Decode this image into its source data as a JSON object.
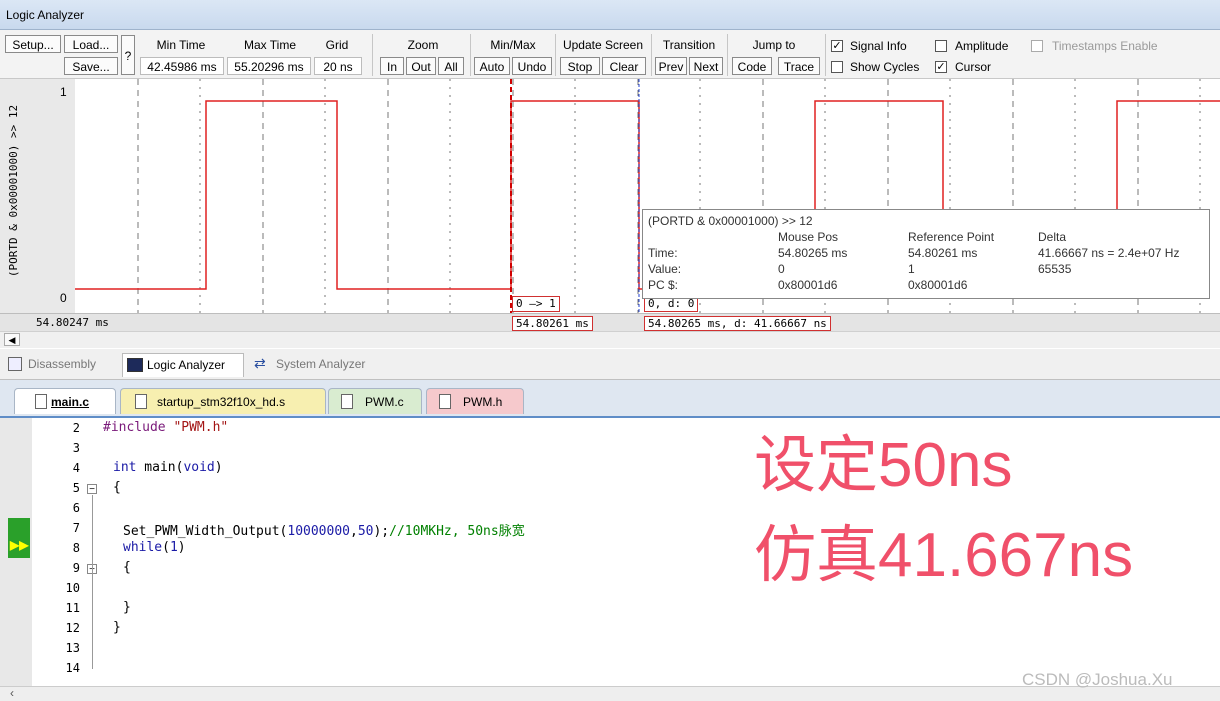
{
  "window": {
    "title": "Logic Analyzer"
  },
  "toolbar": {
    "setup": "Setup...",
    "load": "Load...",
    "save": "Save...",
    "help": "?",
    "min_time_label": "Min Time",
    "min_time_value": "42.45986 ms",
    "max_time_label": "Max Time",
    "max_time_value": "55.20296 ms",
    "grid_label": "Grid",
    "grid_value": "20 ns",
    "zoom_label": "Zoom",
    "zoom_in": "In",
    "zoom_out": "Out",
    "zoom_all": "All",
    "minmax_label": "Min/Max",
    "auto": "Auto",
    "undo": "Undo",
    "update_label": "Update Screen",
    "stop": "Stop",
    "clear": "Clear",
    "transition_label": "Transition",
    "prev": "Prev",
    "next": "Next",
    "jump_label": "Jump to",
    "code": "Code",
    "trace": "Trace",
    "signal_info": "Signal Info",
    "show_cycles": "Show Cycles",
    "amplitude": "Amplitude",
    "cursor": "Cursor",
    "timestamps": "Timestamps Enable",
    "signal_info_checked": true,
    "show_cycles_checked": false,
    "amplitude_checked": false,
    "cursor_checked": true,
    "timestamps_checked": false
  },
  "plot": {
    "signal_name": "(PORTD & 0x00001000) >> 12",
    "y_high": "1",
    "y_low": "0",
    "left_time": "54.80247 ms",
    "transition_label": "0 —> 1",
    "cursor_time": "54.80261 ms",
    "mouse_value_label": "0,   d: 0",
    "mouse_time_label": "54.80265 ms,   d: 41.66667 ns",
    "signal_color": "#e02020"
  },
  "tooltip": {
    "title": "(PORTD & 0x00001000) >> 12",
    "headers": [
      "Mouse Pos",
      "Reference Point",
      "Delta"
    ],
    "rows": [
      {
        "label": "Time:",
        "mouse": "54.80265 ms",
        "ref": "54.80261 ms",
        "delta": "41.66667 ns = 2.4e+07 Hz"
      },
      {
        "label": "Value:",
        "mouse": "0",
        "ref": "1",
        "delta": "65535"
      },
      {
        "label": "PC $:",
        "mouse": "0x80001d6",
        "ref": "0x80001d6",
        "delta": ""
      }
    ]
  },
  "view_tabs": [
    "Disassembly",
    "Logic Analyzer",
    "System Analyzer"
  ],
  "file_tabs": [
    {
      "name": "main.c",
      "color": "#ffffff"
    },
    {
      "name": "startup_stm32f10x_hd.s",
      "color": "#f7efb0"
    },
    {
      "name": "PWM.c",
      "color": "#d9ecd0"
    },
    {
      "name": "PWM.h",
      "color": "#f6c9cc"
    }
  ],
  "code": {
    "line_numbers": [
      "2",
      "3",
      "4",
      "5",
      "6",
      "7",
      "8",
      "9",
      "10",
      "11",
      "12",
      "13",
      "14"
    ],
    "include_directive": "#include",
    "include_file": "\"PWM.h\"",
    "int_kw": "int",
    "main_name": " main(",
    "void_kw": "void",
    "close_paren": ")",
    "open_brace": "{",
    "func_call": "Set_PWM_Width_Output(",
    "arg1": "10000000",
    "comma": ",",
    "arg2": "50",
    "call_end": ");",
    "comment": "//10MKHz, 50ns脉宽",
    "while_kw": "while",
    "while_open": "(",
    "while_arg": "1",
    "while_close": ")",
    "inner_open": "{",
    "inner_close": "}",
    "close_brace": "}"
  },
  "annotation": {
    "line1": "设定50ns",
    "line2": "仿真41.667ns"
  },
  "watermark": "CSDN @Joshua.Xu"
}
